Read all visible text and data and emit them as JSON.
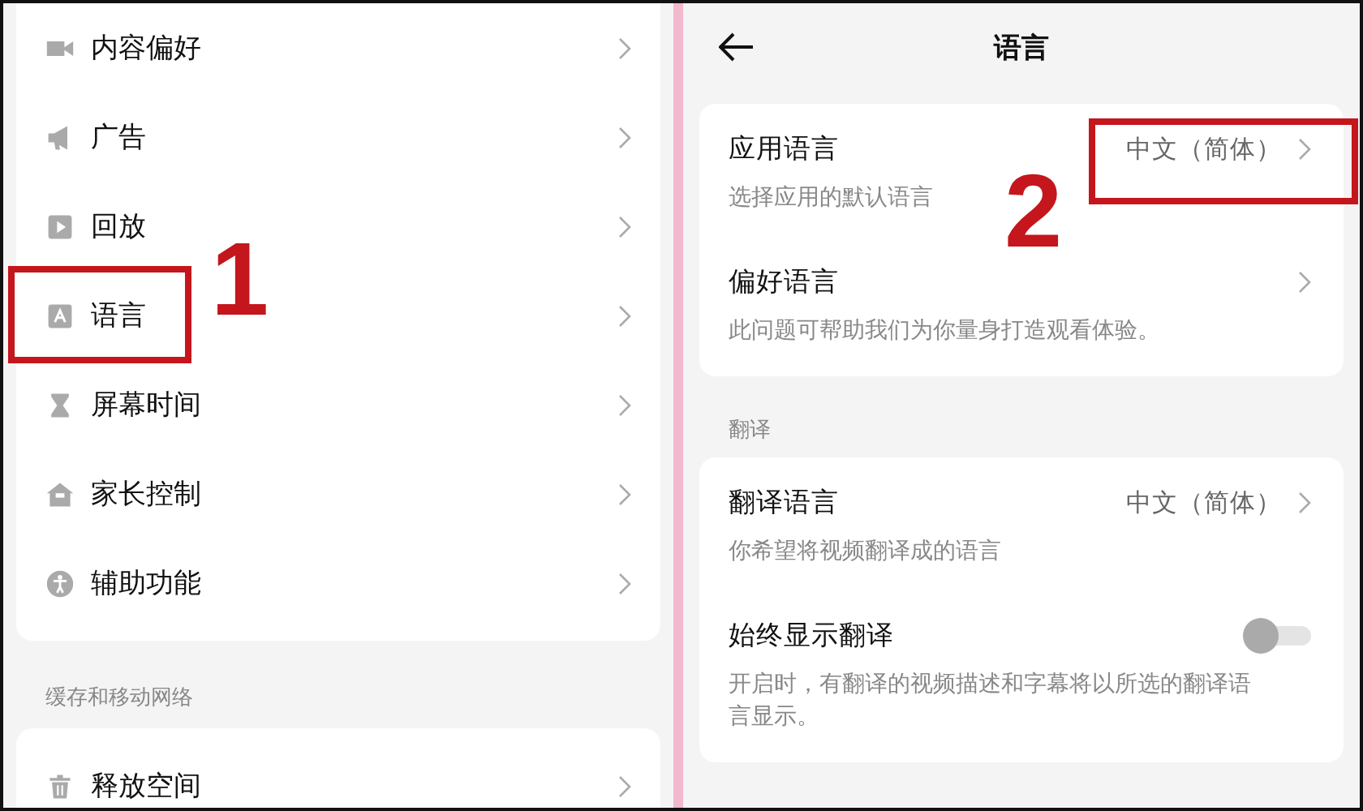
{
  "settings_list": {
    "items": [
      {
        "label": "内容偏好"
      },
      {
        "label": "广告"
      },
      {
        "label": "回放"
      },
      {
        "label": "语言"
      },
      {
        "label": "屏幕时间"
      },
      {
        "label": "家长控制"
      },
      {
        "label": "辅助功能"
      }
    ],
    "section_header": "缓存和移动网络",
    "section_items": [
      {
        "label": "释放空间"
      }
    ]
  },
  "language_screen": {
    "title": "语言",
    "general": [
      {
        "title": "应用语言",
        "value": "中文（简体）",
        "description": "选择应用的默认语言"
      },
      {
        "title": "偏好语言",
        "description": "此问题可帮助我们为你量身打造观看体验。"
      }
    ],
    "translation_header": "翻译",
    "translation": [
      {
        "kind": "link",
        "title": "翻译语言",
        "value": "中文（简体）",
        "description": "你希望将视频翻译成的语言"
      },
      {
        "kind": "toggle",
        "title": "始终显示翻译",
        "on": false,
        "description": "开启时，有翻译的视频描述和字幕将以所选的翻译语言显示。"
      }
    ]
  },
  "annotations": [
    {
      "label": "1"
    },
    {
      "label": "2"
    }
  ]
}
